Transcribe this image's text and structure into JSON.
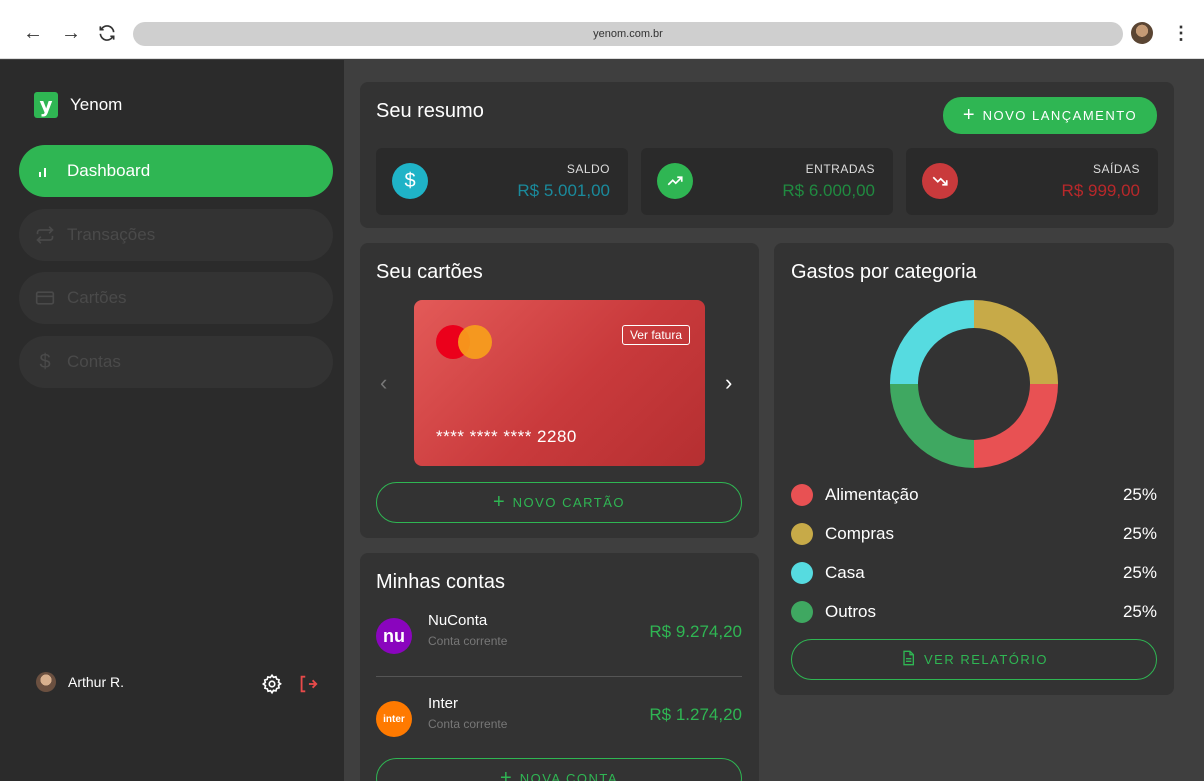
{
  "browser": {
    "url": "yenom.com.br"
  },
  "brand": {
    "name": "Yenom",
    "logo_letter": "y",
    "color": "#2fb653"
  },
  "sidebar": {
    "items": [
      {
        "label": "Dashboard",
        "icon": "bar-chart-icon",
        "active": true
      },
      {
        "label": "Transações",
        "icon": "repeat-icon",
        "active": false
      },
      {
        "label": "Cartões",
        "icon": "credit-card-icon",
        "active": false
      },
      {
        "label": "Contas",
        "icon": "dollar-icon",
        "active": false
      }
    ],
    "user": {
      "name": "Arthur R."
    }
  },
  "summary": {
    "title": "Seu resumo",
    "new_button": "NOVO LANÇAMENTO",
    "stats": [
      {
        "label": "SALDO",
        "value": "R$ 5.001,00",
        "icon": "dollar-icon",
        "color": "#1fb3c7"
      },
      {
        "label": "ENTRADAS",
        "value": "R$ 6.000,00",
        "icon": "trending-up-icon",
        "color": "#2fb653"
      },
      {
        "label": "SAÍDAS",
        "value": "R$ 999,00",
        "icon": "trending-down-icon",
        "color": "#c93a3c"
      }
    ]
  },
  "cards": {
    "title": "Seu cartões",
    "card_number": "**** **** **** 2280",
    "invoice_button": "Ver fatura",
    "new_button": "NOVO CARTÃO"
  },
  "accounts": {
    "title": "Minhas contas",
    "items": [
      {
        "name": "NuConta",
        "type": "Conta corrente",
        "value": "R$ 9.274,20",
        "logo": "nu",
        "color": "#8a05be"
      },
      {
        "name": "Inter",
        "type": "Conta corrente",
        "value": "R$ 1.274,20",
        "logo": "inter",
        "color": "#ff7a00"
      }
    ],
    "new_button": "NOVA CONTA"
  },
  "categories": {
    "title": "Gastos por categoria",
    "report_button": "VER RELATÓRIO",
    "chart_data": {
      "type": "pie",
      "title": "Gastos por categoria",
      "categories": [
        "Alimentação",
        "Compras",
        "Casa",
        "Outros"
      ],
      "values": [
        25,
        25,
        25,
        25
      ],
      "colors": [
        "#e85153",
        "#c7aa48",
        "#56dbe0",
        "#3fa861"
      ],
      "labels": [
        "25%",
        "25%",
        "25%",
        "25%"
      ]
    }
  }
}
